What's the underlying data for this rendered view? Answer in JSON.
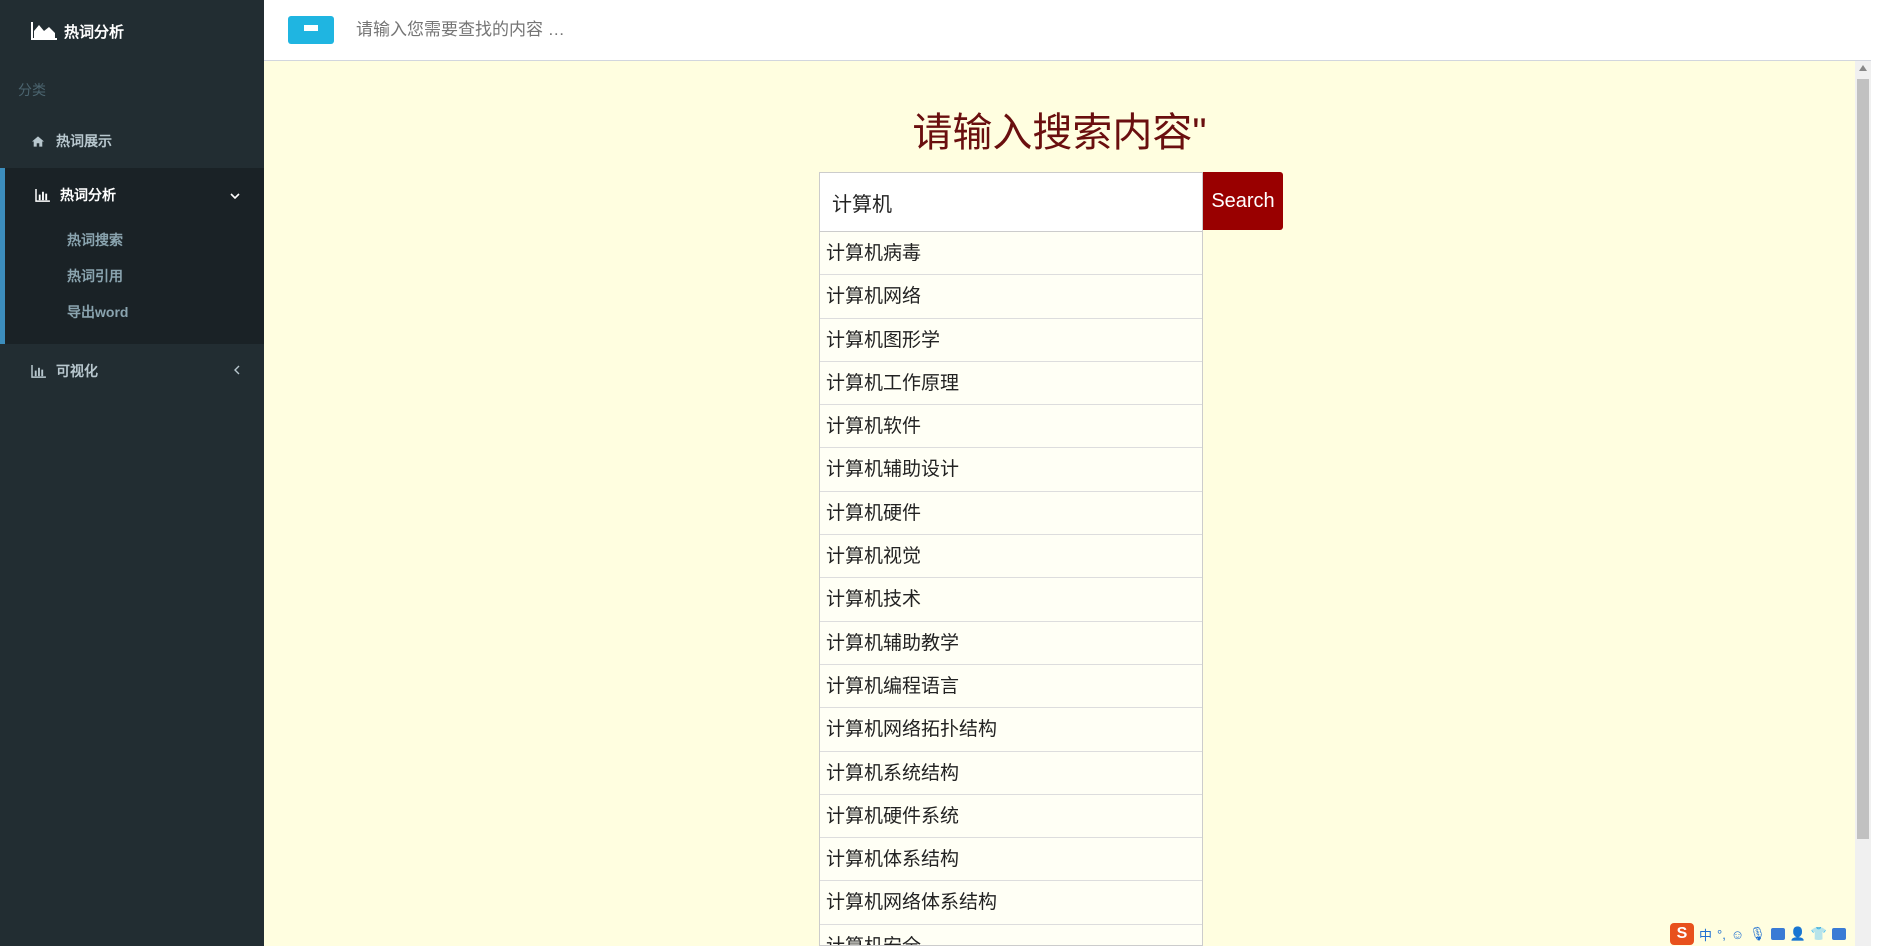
{
  "brand": {
    "title": "热词分析",
    "icon": "area-chart-icon"
  },
  "sidebar": {
    "section_label": "分类",
    "items": [
      {
        "label": "热词展示",
        "icon": "home-icon"
      },
      {
        "label": "热词分析",
        "icon": "bar-chart-icon",
        "expanded": true,
        "children": [
          "热词搜索",
          "热词引用",
          "导出word"
        ]
      },
      {
        "label": "可视化",
        "icon": "bar-chart-icon",
        "expanded": false
      }
    ]
  },
  "header": {
    "search_placeholder": "请输入您需要查找的内容 …",
    "menu_icon": "bars-icon"
  },
  "main": {
    "title": "请输入搜索内容\"",
    "search_value": "计算机",
    "search_button": "Search",
    "suggestions": [
      "计算机病毒",
      "计算机网络",
      "计算机图形学",
      "计算机工作原理",
      "计算机软件",
      "计算机辅助设计",
      "计算机硬件",
      "计算机视觉",
      "计算机技术",
      "计算机辅助教学",
      "计算机编程语言",
      "计算机网络拓扑结构",
      "计算机系统结构",
      "计算机硬件系统",
      "计算机体系结构",
      "计算机网络体系结构",
      "计算机安全"
    ]
  },
  "ime": {
    "logo": "S",
    "mode": "中",
    "punct": "°,"
  },
  "colors": {
    "sidebar_bg": "#222d32",
    "accent": "#3c8dbc",
    "toggle": "#1fb5e1",
    "title": "#6a0f0f",
    "button": "#990000",
    "page_bg": "#fffee0"
  }
}
